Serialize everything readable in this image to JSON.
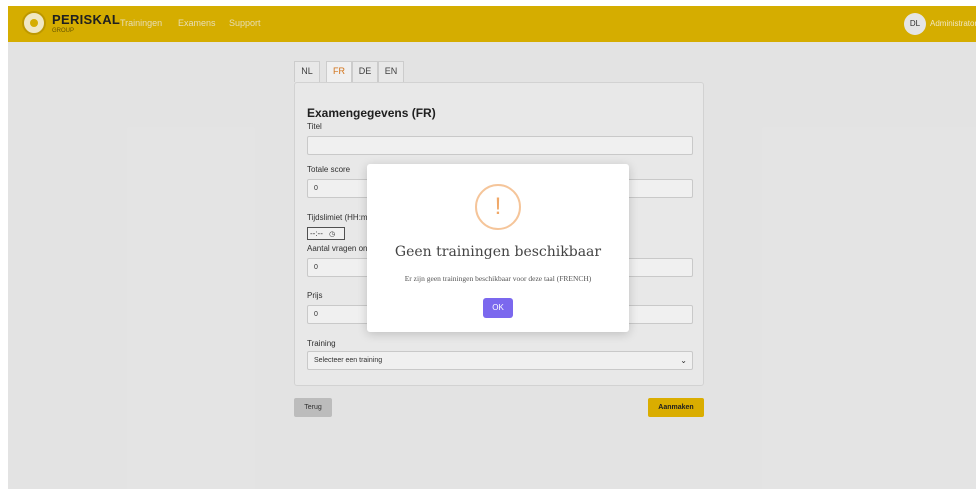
{
  "header": {
    "brand": "PERISKAL",
    "brand_sub": "GROUP",
    "nav": [
      "Trainingen",
      "Examens",
      "Support"
    ],
    "avatar_initials": "DL",
    "user_name": "Administrator"
  },
  "tabs": [
    "NL",
    "FR",
    "DE",
    "EN"
  ],
  "active_tab": "FR",
  "form": {
    "title": "Examengegevens (FR)",
    "titel_label": "Titel",
    "titel_value": "",
    "totale_score_label": "Totale score",
    "totale_score_value": "0",
    "tijdslimiet_label": "Tijdslimiet (HH:m",
    "tijdslimiet_value": "--:--",
    "aantal_vragen_label": "Aantal vragen on",
    "aantal_vragen_value": "0",
    "prijs_label": "Prijs",
    "prijs_value": "0",
    "training_label": "Training",
    "training_select_value": "Selecteer een training"
  },
  "buttons": {
    "back": "Terug",
    "create": "Aanmaken"
  },
  "modal": {
    "icon": "exclamation-icon",
    "title": "Geen trainingen beschikbaar",
    "message": "Er zijn geen trainingen beschikbaar voor deze taal (FRENCH)",
    "ok": "OK"
  },
  "colors": {
    "header_bg": "#e3b800",
    "create_button": "#e8b800",
    "ok_button": "#7b68ee",
    "warning_icon": "#f0a868",
    "active_tab_text": "#e07a1a"
  }
}
